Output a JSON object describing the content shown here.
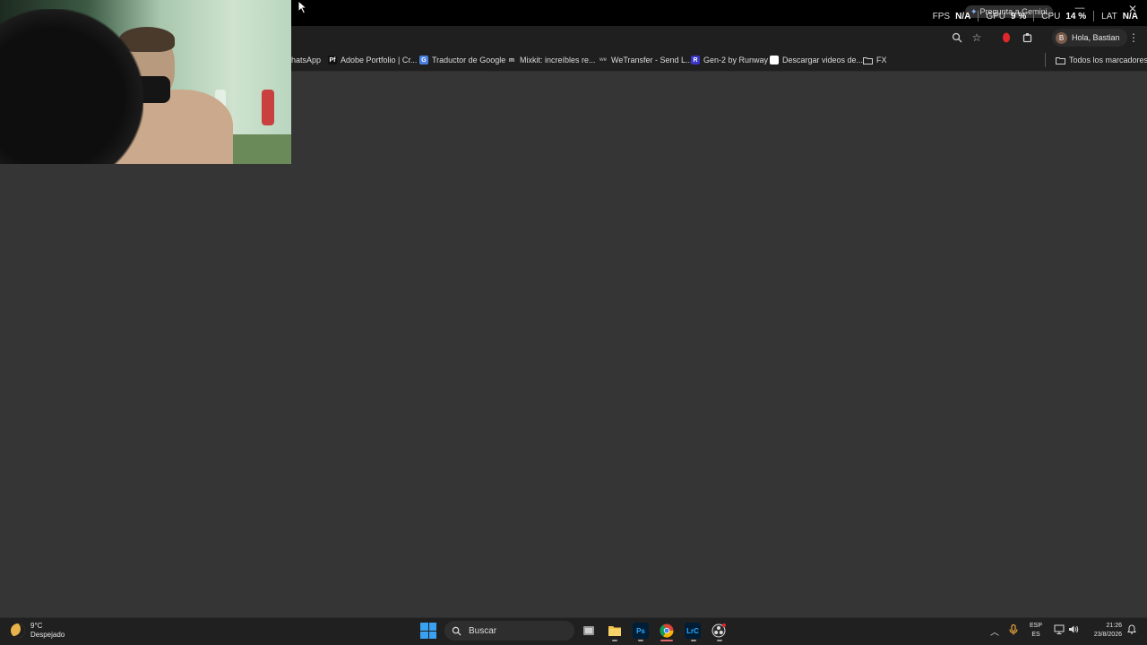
{
  "overlay": {
    "gemini_label": "Pregunta a Gemini",
    "fps_label": "FPS",
    "fps_value": "N/A",
    "gpu_label": "GPU",
    "gpu_value": "9 %",
    "cpu_label": "CPU",
    "cpu_value": "14 %",
    "lat_label": "LAT",
    "lat_value": "N/A"
  },
  "browser": {
    "profile_initial": "B",
    "profile_label": "Hola, Bastian",
    "bookmarks": [
      {
        "label": "hatsApp",
        "icon": "whatsapp-icon"
      },
      {
        "label": "Adobe Portfolio | Cr...",
        "icon": "adobe-portfolio-icon",
        "badge": "Pf"
      },
      {
        "label": "Traductor de Google",
        "icon": "google-translate-icon",
        "badge": "G"
      },
      {
        "label": "Mixkit: increíbles re...",
        "icon": "mixkit-icon",
        "badge": "m"
      },
      {
        "label": "WeTransfer - Send L...",
        "icon": "wetransfer-icon",
        "badge": "we"
      },
      {
        "label": "Gen-2 by Runway",
        "icon": "runway-icon",
        "badge": "R"
      },
      {
        "label": "Descargar videos de...",
        "icon": "page-icon"
      },
      {
        "label": "FX",
        "icon": "folder-icon"
      }
    ],
    "all_bookmarks": "Todos los marcadores"
  },
  "taskbar": {
    "weather_temp": "9°C",
    "weather_desc": "Despejado",
    "search_placeholder": "Buscar",
    "lang_top": "ESP",
    "lang_bottom": "ES",
    "time": "21:26",
    "date": "23/8/2026",
    "apps": [
      {
        "name": "task-view",
        "badge": ""
      },
      {
        "name": "file-explorer",
        "badge": ""
      },
      {
        "name": "photoshop",
        "badge": "Ps"
      },
      {
        "name": "chrome",
        "badge": ""
      },
      {
        "name": "lightroom-classic",
        "badge": "LrC"
      },
      {
        "name": "obs",
        "badge": ""
      }
    ]
  },
  "colors": {
    "accent_blue": "#3aa0f0",
    "background": "#353535",
    "record_red": "#e0282c"
  }
}
